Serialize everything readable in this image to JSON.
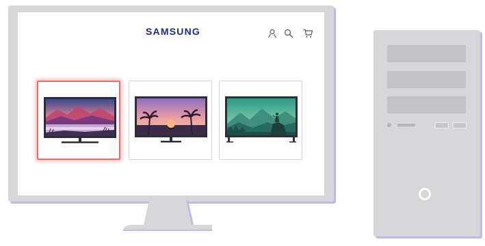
{
  "header": {
    "brand": "SAMSUNG",
    "icons": [
      "user-icon",
      "search-icon",
      "cart-icon"
    ]
  },
  "products": [
    {
      "name": "tv-sunset-lake",
      "selected": true
    },
    {
      "name": "tv-palm-beach",
      "selected": false
    },
    {
      "name": "tv-mountain-hiker",
      "selected": false
    }
  ],
  "colors": {
    "brand": "#1b2a88",
    "selection": "#f06868",
    "device": "#d7d7d9",
    "device_shadow": "#bdbde3"
  }
}
